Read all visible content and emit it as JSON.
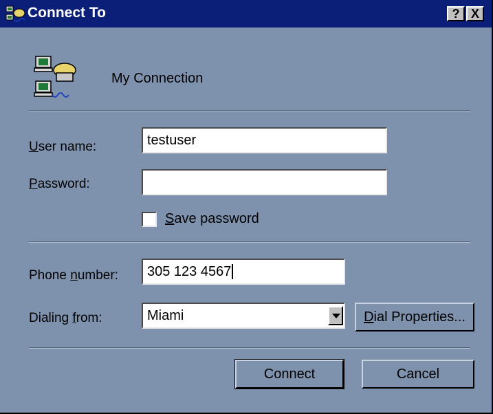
{
  "window": {
    "title": "Connect To",
    "help_button": "?",
    "close_button": "X"
  },
  "connection": {
    "name": "My Connection"
  },
  "form": {
    "username_label_accel": "U",
    "username_label_rest": "ser name:",
    "username_value": "testuser",
    "password_label_accel": "P",
    "password_label_rest": "assword:",
    "password_value": "",
    "save_password_accel": "S",
    "save_password_rest": "ave password",
    "save_password_checked": false,
    "phone_label_pre": "Phone ",
    "phone_label_accel": "n",
    "phone_label_rest": "umber:",
    "phone_value": "305 123 4567",
    "dialing_label_pre": "Dialing ",
    "dialing_label_accel": "f",
    "dialing_label_rest": "rom:",
    "dialing_value": "Miami"
  },
  "buttons": {
    "dial_properties_accel": "D",
    "dial_properties_rest": "ial Properties...",
    "connect": "Connect",
    "cancel": "Cancel"
  },
  "colors": {
    "dialog_bg": "#7e92ad",
    "titlebar_bg": "#0b1f78",
    "titlebar_text": "#ffffff"
  }
}
